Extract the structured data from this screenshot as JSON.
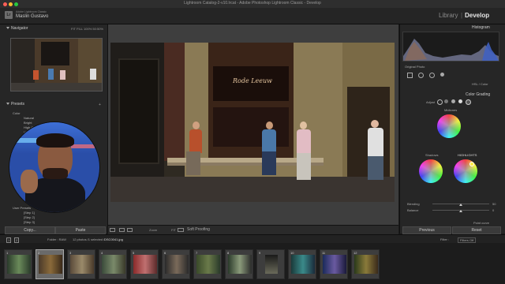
{
  "window": {
    "title": "Lightroom Catalog-2-v10.lrcat - Adobe Photoshop Lightroom Classic - Develop"
  },
  "header": {
    "catalog_sub": "Adobe Lightroom Classic",
    "user_name": "Maslin Gustavo",
    "modules": {
      "library": "Library",
      "separator": "|",
      "develop": "Develop"
    }
  },
  "left_panel": {
    "navigator": {
      "title": "Navigator",
      "zoom_options": [
        "FIT",
        "FILL",
        "100%",
        "50:50%"
      ]
    },
    "presets": {
      "title": "Presets",
      "items": [
        "Color",
        "Natural",
        "Bright",
        "High Contrast",
        "Vintage 1",
        "B&W",
        "Flat",
        "User Presets",
        "[Step 1]",
        "[Step 2]",
        "[Step 3]"
      ]
    },
    "buttons": {
      "copy": "Copy...",
      "paste": "Paste"
    }
  },
  "right_panel": {
    "histogram": {
      "title": "Histogram",
      "original_photo": "Original Photo"
    },
    "hsl": {
      "label": "HSL / Color"
    },
    "color_grading": {
      "title": "Color Grading",
      "adjust_label": "Adjust",
      "wheels": {
        "midtones": "Midtones",
        "shadows": "Shadows",
        "highlights": "HIGHLIGHTS"
      },
      "blending_label": "Blending",
      "balance_label": "Balance",
      "blending_value": "50",
      "balance_value": "0",
      "point_curve": "Point curve"
    },
    "buttons": {
      "previous": "Previous",
      "reset": "Reset"
    }
  },
  "toolbar": {
    "zoom_label": "Zoom",
    "zoom_value": "FIT",
    "soft_proofing": "Soft Proofing"
  },
  "filmstrip_bar": {
    "pages": [
      "1",
      "2"
    ],
    "folder": "Folder : RAW",
    "count": "12 photos /1 selected /",
    "filename": "DSC0041.jpg",
    "filter_label": "Filter :",
    "filter_value": "Filters Off"
  },
  "filmstrip": {
    "numbers": [
      "1",
      "2",
      "3",
      "4",
      "5",
      "6",
      "7",
      "8",
      "9",
      "10",
      "11",
      "12"
    ]
  },
  "photo": {
    "shop_sign": "Rode Leeuw"
  },
  "colors": {
    "accent": "#e6e6e6",
    "panel_bg": "#262626",
    "webcam_blue": "#2a4ea8",
    "close": "#ff5f57",
    "minimize": "#febc2e",
    "maximize": "#28c840"
  },
  "icons": [
    "close-light",
    "minimize-light",
    "maximize-light",
    "triangle-icon",
    "loupe-view-icon",
    "before-after-icon",
    "eyedropper-icon"
  ]
}
